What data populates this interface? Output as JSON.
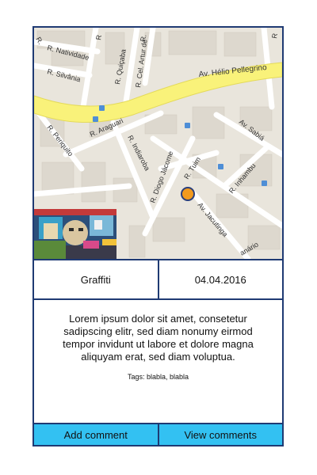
{
  "map": {
    "streets": {
      "natividade": "R. Natividade",
      "silvania": "R. Silvânia",
      "quicaba": "R. Quiçaba",
      "arturde": "R. Cel. Artur de",
      "helio": "Av. Hélio Pellegrino",
      "araguari": "R. Araguari",
      "periquito": "R. Periquito",
      "indiaroba": "R. Indiaroba",
      "jacome": "R. Diogo Jácome",
      "tuim": "R. Tuim",
      "sabia": "Av. Sabiá",
      "inhambu": "R. Inhambu",
      "jacutinga": "Av. Jacutinga",
      "canario": "anário",
      "r_top1": "R",
      "r_top2": "R.",
      "r_left": "R.",
      "r_right": "R"
    },
    "marker_color": "#f29a1d",
    "highway_color": "#f9f27a"
  },
  "info": {
    "category": "Graffiti",
    "date": "04.04.2016"
  },
  "description": {
    "text": "Lorem ipsum dolor sit amet, consetetur sadipscing elitr, sed diam nonumy eirmod tempor invidunt ut labore et dolore magna aliquyam erat, sed diam voluptua.",
    "tags": "Tags: blabla, blabla"
  },
  "buttons": {
    "add_comment": "Add comment",
    "view_comments": "View comments"
  },
  "colors": {
    "border": "#1f3a73",
    "button_bg": "#33c1f2"
  }
}
